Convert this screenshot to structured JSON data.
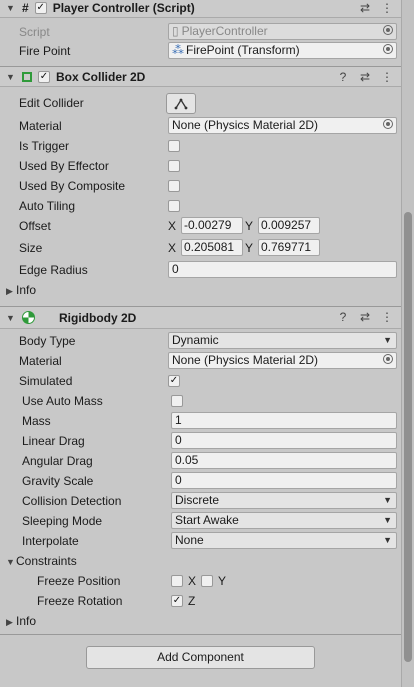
{
  "player_controller": {
    "hash_icon": "#",
    "title": "Player Controller (Script)",
    "script_label": "Script",
    "script_value": "PlayerController",
    "fire_point_label": "Fire Point",
    "fire_point_value": "FirePoint (Transform)"
  },
  "box_collider": {
    "title": "Box Collider 2D",
    "edit_collider_label": "Edit Collider",
    "material_label": "Material",
    "material_value": "None (Physics Material 2D)",
    "is_trigger_label": "Is Trigger",
    "used_by_effector_label": "Used By Effector",
    "used_by_composite_label": "Used By Composite",
    "auto_tiling_label": "Auto Tiling",
    "offset_label": "Offset",
    "offset_x_axis": "X",
    "offset_x": "-0.00279",
    "offset_y_axis": "Y",
    "offset_y": "0.009257",
    "size_label": "Size",
    "size_x_axis": "X",
    "size_x": "0.205081",
    "size_y_axis": "Y",
    "size_y": "0.769771",
    "edge_radius_label": "Edge Radius",
    "edge_radius_value": "0",
    "info_label": "Info"
  },
  "rigidbody": {
    "title": "Rigidbody 2D",
    "body_type_label": "Body Type",
    "body_type_value": "Dynamic",
    "material_label": "Material",
    "material_value": "None (Physics Material 2D)",
    "simulated_label": "Simulated",
    "use_auto_mass_label": "Use Auto Mass",
    "mass_label": "Mass",
    "mass_value": "1",
    "linear_drag_label": "Linear Drag",
    "linear_drag_value": "0",
    "angular_drag_label": "Angular Drag",
    "angular_drag_value": "0.05",
    "gravity_scale_label": "Gravity Scale",
    "gravity_scale_value": "0",
    "collision_detection_label": "Collision Detection",
    "collision_detection_value": "Discrete",
    "sleeping_mode_label": "Sleeping Mode",
    "sleeping_mode_value": "Start Awake",
    "interpolate_label": "Interpolate",
    "interpolate_value": "None",
    "constraints_label": "Constraints",
    "freeze_position_label": "Freeze Position",
    "freeze_position_x": "X",
    "freeze_position_y": "Y",
    "freeze_rotation_label": "Freeze Rotation",
    "freeze_rotation_z": "Z",
    "info_label": "Info"
  },
  "add_component_label": "Add Component",
  "icons": {
    "help": "?",
    "presets": "⇄",
    "menu": "⋮",
    "check": "✓",
    "fold_open": "▼",
    "fold_closed": "▶",
    "dropdown": "▼"
  }
}
